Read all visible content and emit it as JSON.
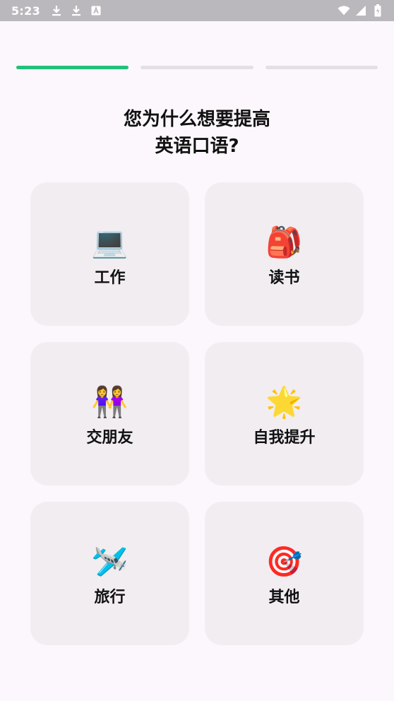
{
  "status_bar": {
    "time": "5:23",
    "left_icons": [
      "download-icon",
      "download-icon",
      "a-box-icon"
    ],
    "right_icons": [
      "wifi-icon",
      "signal-icon",
      "battery-icon"
    ]
  },
  "progress": {
    "steps_total": 3,
    "steps_done": 1,
    "active_color": "#21c17a",
    "inactive_color": "#e3dfe3"
  },
  "question": {
    "line1": "您为什么想要提高",
    "line2": "英语口语?"
  },
  "options": [
    {
      "emoji": "💻",
      "icon": "laptop-icon",
      "label": "工作"
    },
    {
      "emoji": "🎒",
      "icon": "backpack-icon",
      "label": "读书"
    },
    {
      "emoji": "👭",
      "icon": "friends-icon",
      "label": "交朋友"
    },
    {
      "emoji": "🌟",
      "icon": "star-icon",
      "label": "自我提升"
    },
    {
      "emoji": "🛩️",
      "icon": "airplane-icon",
      "label": "旅行"
    },
    {
      "emoji": "🎯",
      "icon": "target-icon",
      "label": "其他"
    }
  ]
}
